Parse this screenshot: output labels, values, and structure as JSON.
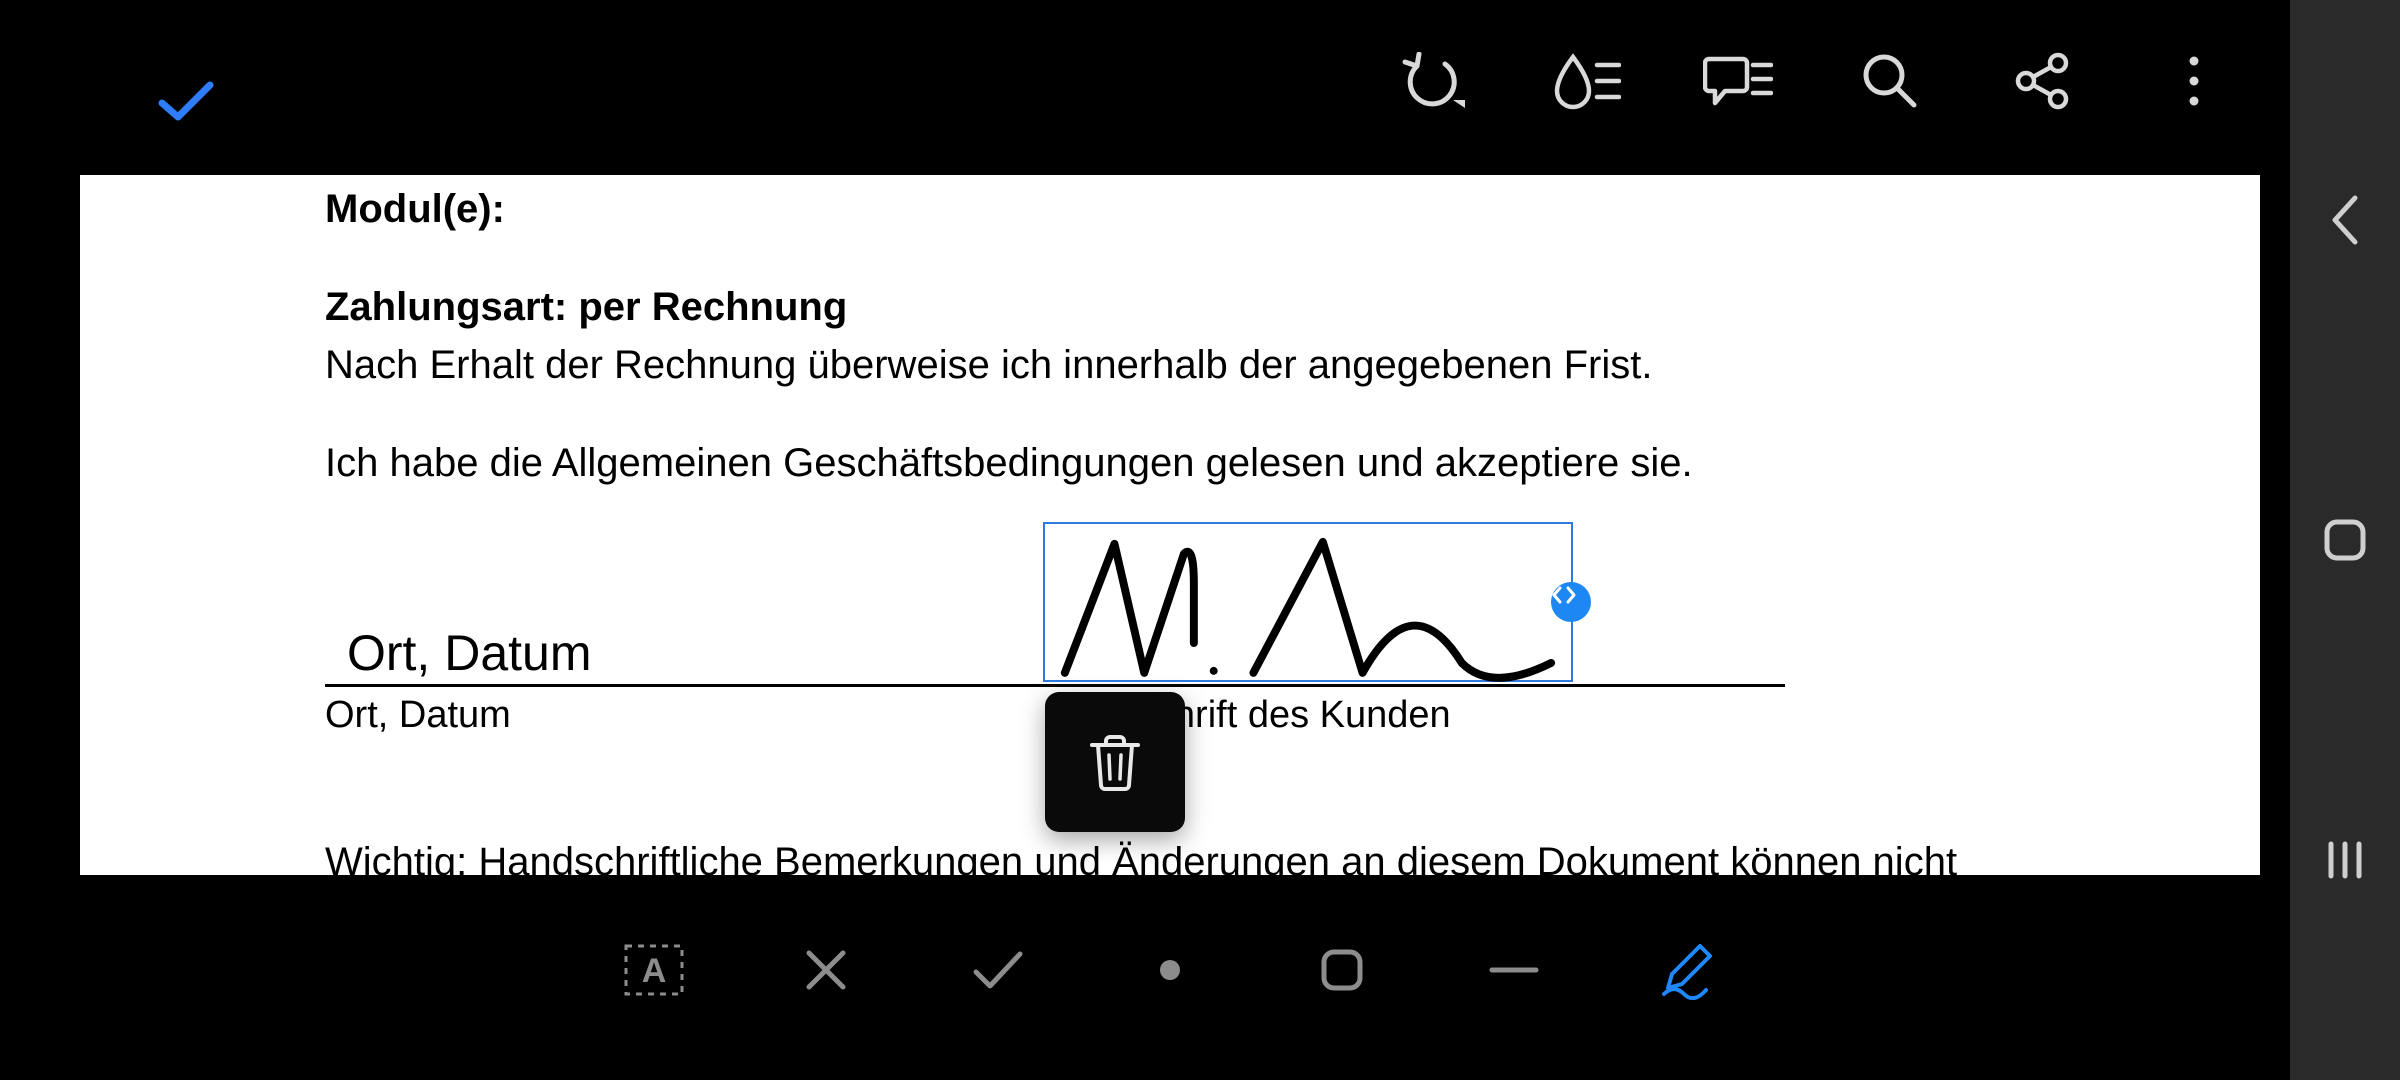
{
  "topbar": {
    "icons": {
      "confirm": "confirm-check",
      "undo": "undo",
      "ink": "ink-settings",
      "comment": "comment-list",
      "search": "search",
      "share": "share",
      "more": "more-vertical"
    }
  },
  "document": {
    "module_label": "Modul(e):",
    "zahlung_label": "Zahlungsart: per Rechnung",
    "zahlung_text": "Nach Erhalt der Rechnung überweise ich innerhalb der angegebenen Frist.",
    "agb_text": "Ich habe die Allgemeinen Geschäftsbedingungen gelesen und akzeptiere sie.",
    "ort_datum_value": "Ort, Datum",
    "ort_datum_label": "Ort, Datum",
    "unterschrift_label": "Unterschrift des Kunden",
    "bottom_note": "Wichtig: Handschriftliche Bemerkungen und Änderungen an diesem Dokument können nicht"
  },
  "signature": {
    "selected": true,
    "colors": {
      "box_border": "#2f7adf",
      "handle": "#1d87f4",
      "ink": "#000000"
    }
  },
  "popover": {
    "action": "delete"
  },
  "bottombar": {
    "tools": {
      "text": "text-box",
      "cross": "cross-mark",
      "check": "check-mark",
      "dot": "dot",
      "square": "rounded-square",
      "line": "line",
      "pen": "signature-pen"
    },
    "active": "pen",
    "colors": {
      "default": "#8c8c8c",
      "active": "#1e88ff"
    }
  },
  "sysnav": {
    "back": "back",
    "home": "home",
    "recents": "recents"
  }
}
